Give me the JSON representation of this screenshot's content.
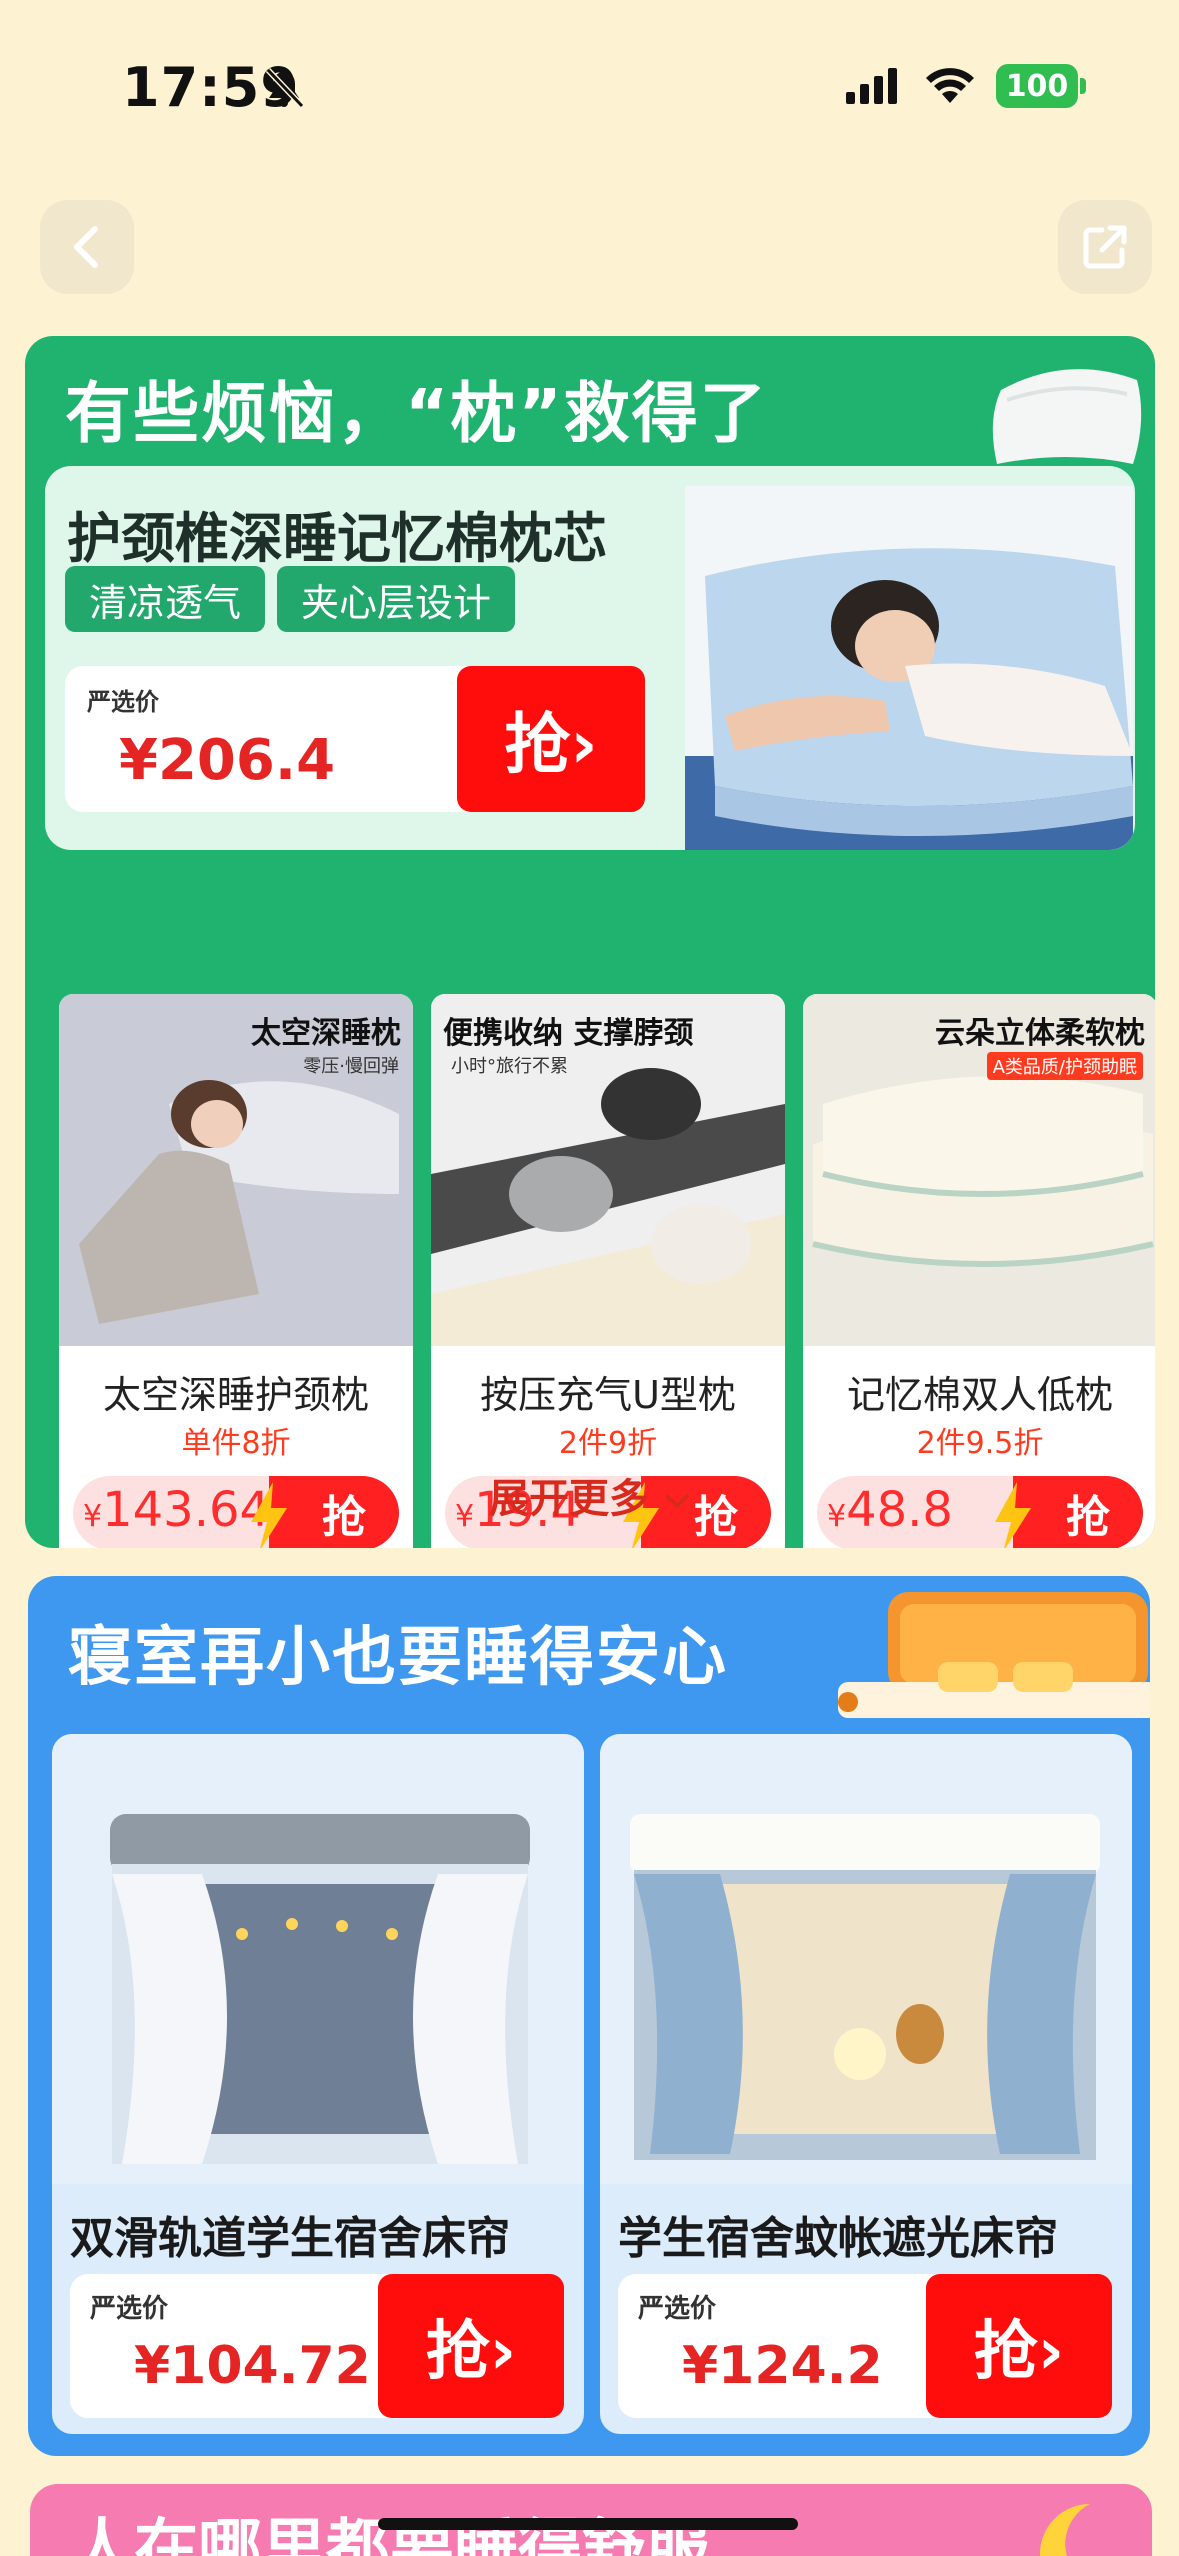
{
  "status_bar": {
    "time": "17:59",
    "battery": "100"
  },
  "nav": {
    "back_icon": "chevron-left-icon",
    "share_icon": "share-icon"
  },
  "section1": {
    "title": "有些烦恼，“枕”救得了",
    "featured": {
      "name": "护颈椎深睡记忆棉枕芯",
      "tags": [
        "清凉透气",
        "夹心层设计"
      ],
      "price_label": "严选价",
      "price": "¥206.4",
      "grab_label": "抢›"
    },
    "cards": [
      {
        "overlay": "太空深睡枕",
        "overlay_sub": "零压·慢回弹",
        "name": "太空深睡护颈枕",
        "promo": "单件8折",
        "price": "143.64",
        "grab": "抢"
      },
      {
        "overlay": "便携收纳 支撑脖颈",
        "overlay_sub": "小时°旅行不累",
        "name": "按压充气U型枕",
        "promo": "2件9折",
        "price": "19.4",
        "grab": "抢"
      },
      {
        "overlay": "云朵立体柔软枕",
        "overlay_sub": "A类品质/护颈助眠",
        "name": "记忆棉双人低枕",
        "promo": "2件9.5折",
        "price": "48.8",
        "grab": "抢"
      }
    ],
    "more_label": "展开更多"
  },
  "section2": {
    "title": "寝室再小也要睡得安心",
    "products": [
      {
        "name": "双滑轨道学生宿舍床帘",
        "price_label": "严选价",
        "price": "¥104.72",
        "grab": "抢›"
      },
      {
        "name": "学生宿舍蚊帐遮光床帘",
        "price_label": "严选价",
        "price": "¥124.2",
        "grab": "抢›"
      }
    ]
  },
  "section3": {
    "title": "人在哪里都要睡得舒服"
  },
  "colors": {
    "green": "#20b36f",
    "blue": "#3e98ef",
    "pink": "#f67bb1",
    "red": "#ff0c0c",
    "bg": "#fdf2d2"
  }
}
